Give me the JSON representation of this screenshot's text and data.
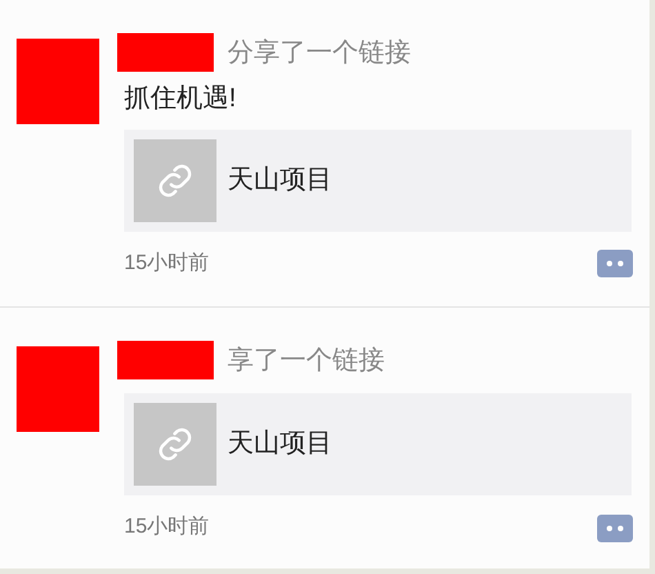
{
  "posts": [
    {
      "action": "分享了一个链接",
      "text": "抓住机遇!",
      "link": {
        "title": "天山项目"
      },
      "time": "15小时前"
    },
    {
      "action": "享了一个链接",
      "link": {
        "title": "天山项目"
      },
      "time": "15小时前"
    }
  ]
}
